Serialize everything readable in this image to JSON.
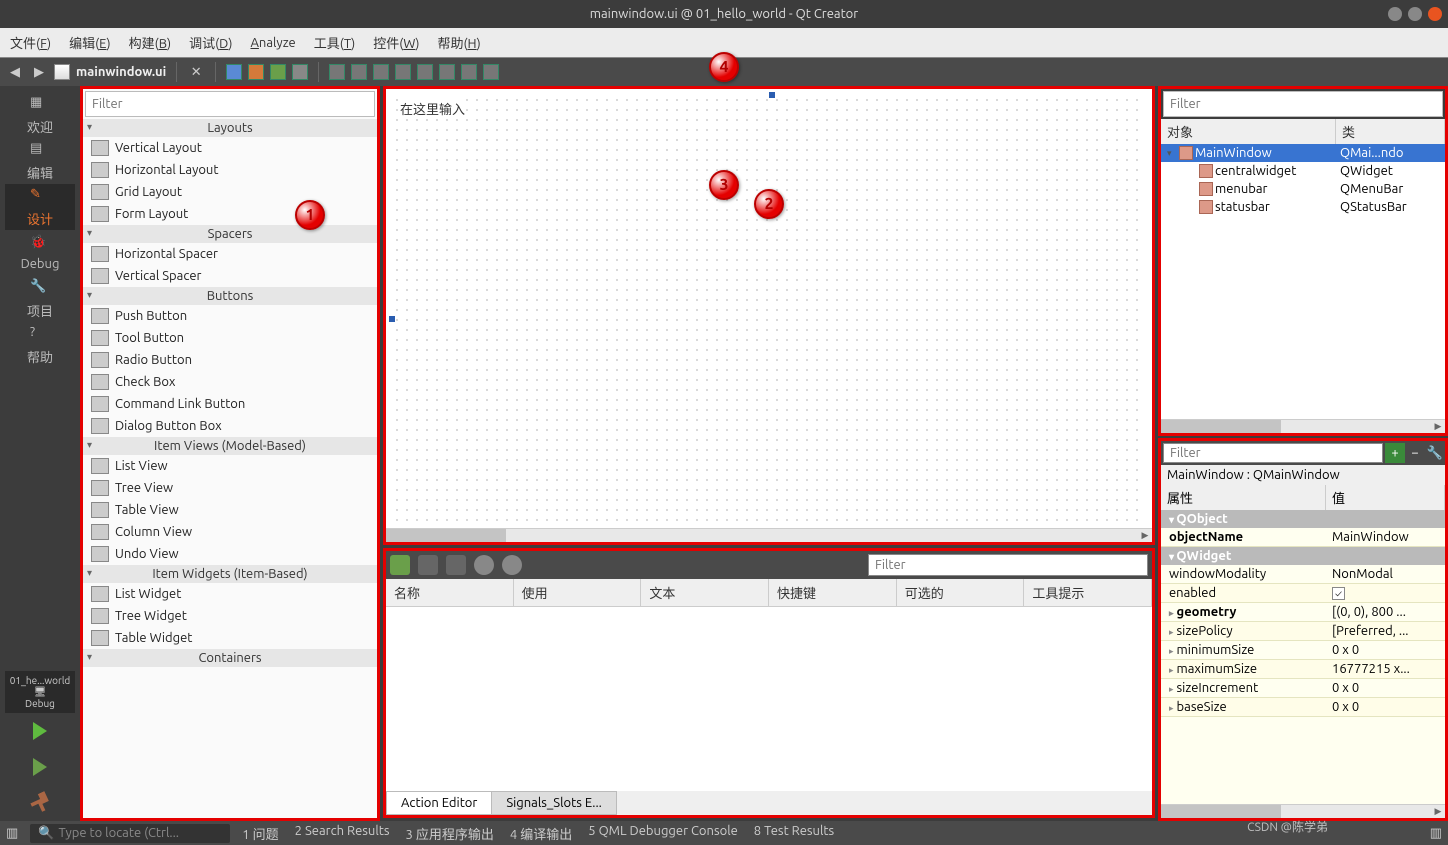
{
  "window": {
    "title": "mainwindow.ui @ 01_hello_world - Qt Creator"
  },
  "menubar": [
    "文件(F)",
    "编辑(E)",
    "构建(B)",
    "调试(D)",
    "Analyze",
    "工具(T)",
    "控件(W)",
    "帮助(H)"
  ],
  "docbar": {
    "filename": "mainwindow.ui"
  },
  "leftbar": {
    "modes": [
      "欢迎",
      "编辑",
      "设计",
      "Debug",
      "项目",
      "帮助"
    ],
    "active": 2,
    "project": "01_he...world",
    "debug_label": "Debug"
  },
  "widgetbox": {
    "filter_placeholder": "Filter",
    "categories": [
      {
        "name": "Layouts",
        "items": [
          "Vertical Layout",
          "Horizontal Layout",
          "Grid Layout",
          "Form Layout"
        ]
      },
      {
        "name": "Spacers",
        "items": [
          "Horizontal Spacer",
          "Vertical Spacer"
        ]
      },
      {
        "name": "Buttons",
        "items": [
          "Push Button",
          "Tool Button",
          "Radio Button",
          "Check Box",
          "Command Link Button",
          "Dialog Button Box"
        ]
      },
      {
        "name": "Item Views (Model-Based)",
        "items": [
          "List View",
          "Tree View",
          "Table View",
          "Column View",
          "Undo View"
        ]
      },
      {
        "name": "Item Widgets (Item-Based)",
        "items": [
          "List Widget",
          "Tree Widget",
          "Table Widget"
        ]
      },
      {
        "name": "Containers",
        "items": []
      }
    ]
  },
  "canvas": {
    "menu_hint": "在这里输入"
  },
  "action_editor": {
    "filter_placeholder": "Filter",
    "columns": [
      "名称",
      "使用",
      "文本",
      "快捷键",
      "可选的",
      "工具提示"
    ],
    "tabs": [
      "Action Editor",
      "Signals_Slots E..."
    ],
    "active_tab": 0
  },
  "object_inspector": {
    "filter_placeholder": "Filter",
    "columns": [
      "对象",
      "类"
    ],
    "tree": [
      {
        "name": "MainWindow",
        "class": "QMai...ndo",
        "depth": 0,
        "sel": true,
        "exp": "▾"
      },
      {
        "name": "centralwidget",
        "class": "QWidget",
        "depth": 1,
        "exp": ""
      },
      {
        "name": "menubar",
        "class": "QMenuBar",
        "depth": 1,
        "exp": ""
      },
      {
        "name": "statusbar",
        "class": "QStatusBar",
        "depth": 1,
        "exp": ""
      }
    ]
  },
  "property_editor": {
    "filter_placeholder": "Filter",
    "title": "MainWindow : QMainWindow",
    "columns": [
      "属性",
      "值"
    ],
    "groups": [
      {
        "name": "QObject",
        "rows": [
          {
            "k": "objectName",
            "v": "MainWindow",
            "bold": true
          }
        ]
      },
      {
        "name": "QWidget",
        "rows": [
          {
            "k": "windowModality",
            "v": "NonModal"
          },
          {
            "k": "enabled",
            "v": "",
            "check": true
          },
          {
            "k": "geometry",
            "v": "[(0, 0), 800 ...",
            "bold": true,
            "exp": true
          },
          {
            "k": "sizePolicy",
            "v": "[Preferred, ...",
            "exp": true
          },
          {
            "k": "minimumSize",
            "v": "0 x 0",
            "exp": true
          },
          {
            "k": "maximumSize",
            "v": "16777215 x...",
            "exp": true
          },
          {
            "k": "sizeIncrement",
            "v": "0 x 0",
            "exp": true
          },
          {
            "k": "baseSize",
            "v": "0 x 0",
            "exp": true
          }
        ]
      }
    ]
  },
  "statusbar": {
    "locator": "Type to locate (Ctrl...",
    "outputs": [
      {
        "n": "1",
        "label": "问题"
      },
      {
        "n": "2",
        "label": "Search Results"
      },
      {
        "n": "3",
        "label": "应用程序输出"
      },
      {
        "n": "4",
        "label": "编译输出"
      },
      {
        "n": "5",
        "label": "QML Debugger Console"
      },
      {
        "n": "8",
        "label": "Test Results"
      }
    ]
  },
  "badges": [
    "1",
    "2",
    "3",
    "4"
  ],
  "watermark": "CSDN @陈学弟"
}
